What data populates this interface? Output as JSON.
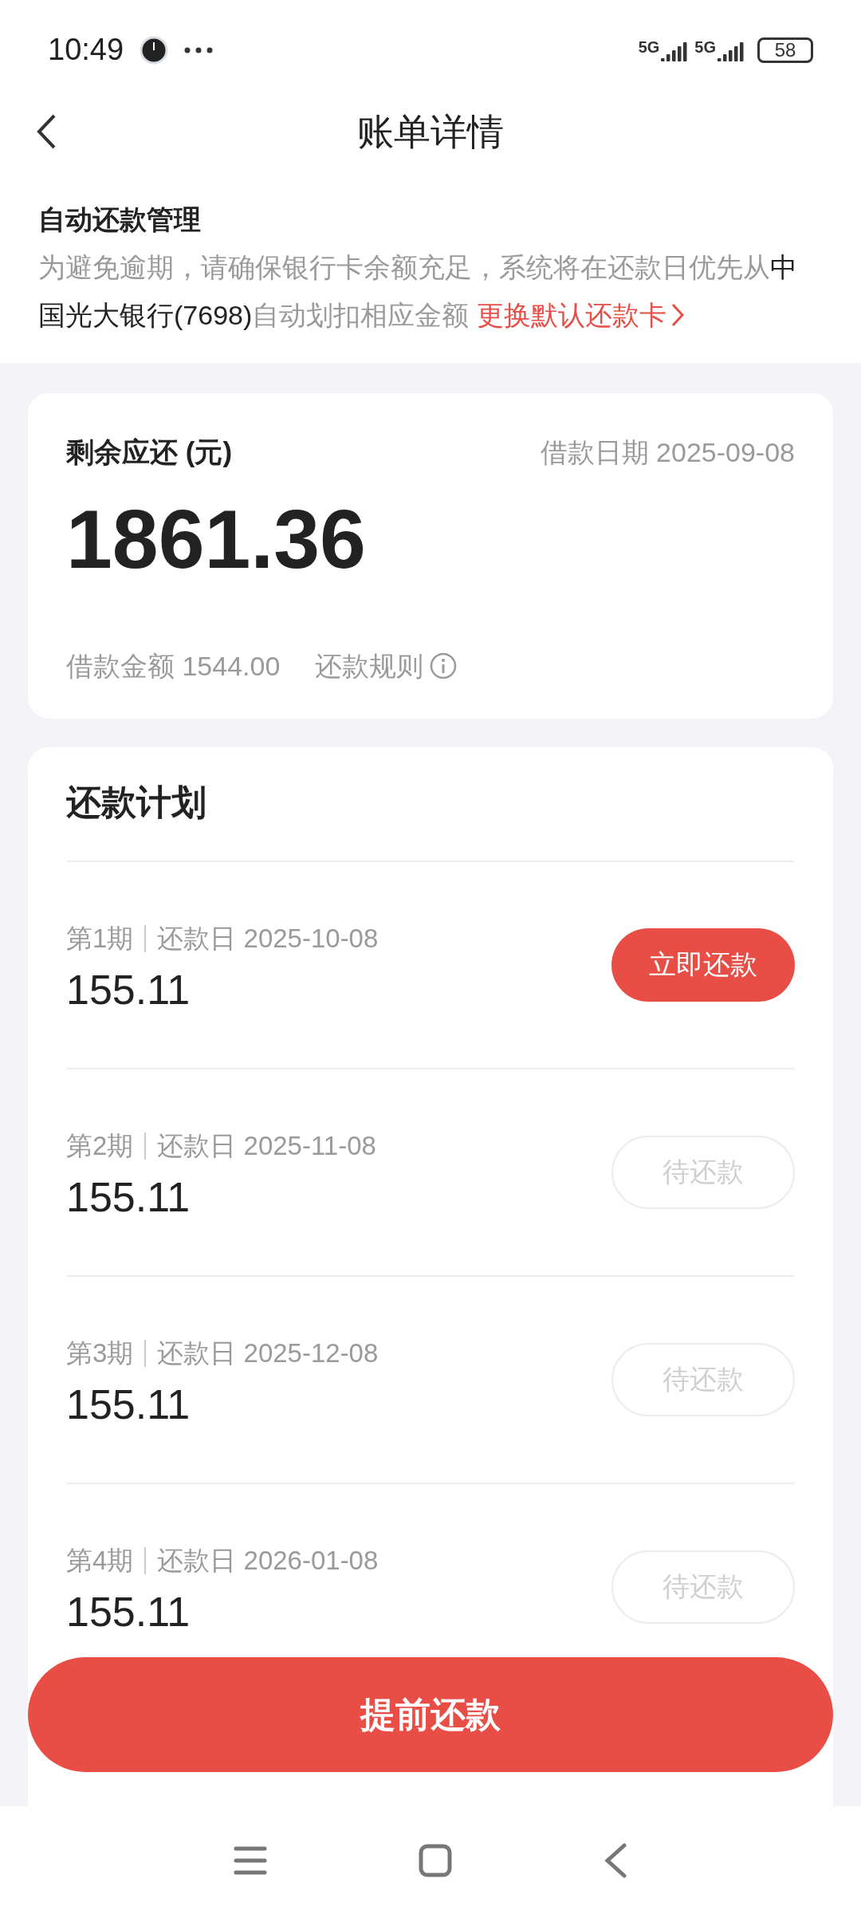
{
  "status_bar": {
    "time": "10:49",
    "signals": [
      "5G",
      "5G"
    ],
    "battery": "58"
  },
  "header": {
    "title": "账单详情"
  },
  "auto_repay": {
    "title": "自动还款管理",
    "notice_before": "为避免逾期，请确保银行卡余额充足，系统将在还款日优先从",
    "bank": "中国光大银行(7698)",
    "notice_after": "自动划扣相应金额",
    "link": "更换默认还款卡"
  },
  "summary": {
    "label": "剩余应还 (元)",
    "loan_date": "借款日期 2025-09-08",
    "amount": "1861.36",
    "loan_amount": "借款金额 1544.00",
    "rules": "还款规则"
  },
  "plan": {
    "title": "还款计划",
    "installments": [
      {
        "period": "第1期",
        "due": "还款日 2025-10-08",
        "amount": "155.11",
        "kind": "pay",
        "action": "立即还款"
      },
      {
        "period": "第2期",
        "due": "还款日 2025-11-08",
        "amount": "155.11",
        "kind": "pending",
        "action": "待还款"
      },
      {
        "period": "第3期",
        "due": "还款日 2025-12-08",
        "amount": "155.11",
        "kind": "pending",
        "action": "待还款"
      },
      {
        "period": "第4期",
        "due": "还款日 2026-01-08",
        "amount": "155.11",
        "kind": "pending",
        "action": "待还款"
      }
    ]
  },
  "bottom_button": "提前还款"
}
